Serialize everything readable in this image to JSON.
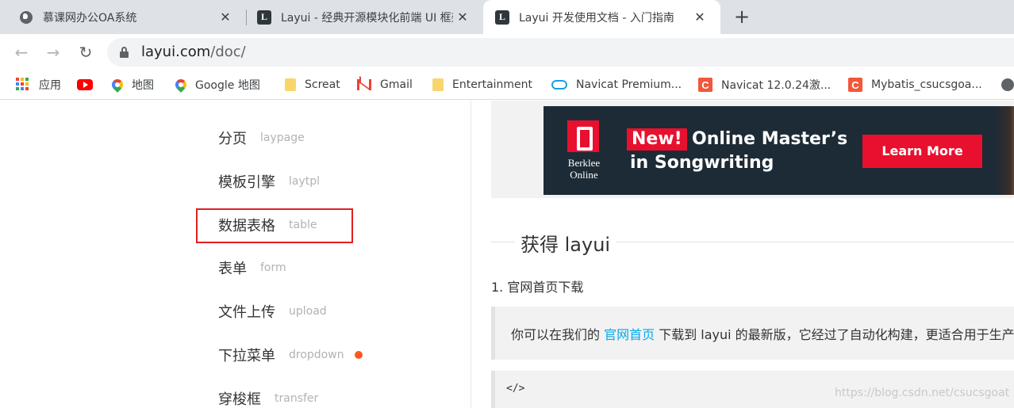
{
  "tabs": [
    {
      "title": "慕课网办公OA系统",
      "icon": "globe-icon",
      "active": false
    },
    {
      "title": "Layui - 经典开源模块化前端 UI 框架",
      "icon": "layui-logo-icon",
      "active": false
    },
    {
      "title": "Layui 开发使用文档 - 入门指南",
      "icon": "layui-logo-icon",
      "active": true
    }
  ],
  "toolbar": {
    "url_host": "layui.com",
    "url_path": "/doc/"
  },
  "bookmarks": [
    {
      "label": "应用",
      "icon": "apps-grid-icon"
    },
    {
      "label": "",
      "icon": "youtube-icon"
    },
    {
      "label": "地图",
      "icon": "maps-pin-icon"
    },
    {
      "label": "Google 地图",
      "icon": "maps-pin-icon"
    },
    {
      "label": "Screat",
      "icon": "folder-icon"
    },
    {
      "label": "Gmail",
      "icon": "gmail-icon"
    },
    {
      "label": "Entertainment",
      "icon": "folder-icon"
    },
    {
      "label": "Navicat Premium...",
      "icon": "cloud-icon"
    },
    {
      "label": "Navicat 12.0.24激...",
      "icon": "csdn-c-icon"
    },
    {
      "label": "Mybatis_csucsgoa...",
      "icon": "csdn-c-icon"
    }
  ],
  "sidebar": {
    "items": [
      {
        "zh": "分页",
        "en": "laypage"
      },
      {
        "zh": "模板引擎",
        "en": "laytpl"
      },
      {
        "zh": "数据表格",
        "en": "table"
      },
      {
        "zh": "表单",
        "en": "form"
      },
      {
        "zh": "文件上传",
        "en": "upload"
      },
      {
        "zh": "下拉菜单",
        "en": "dropdown"
      },
      {
        "zh": "穿梭框",
        "en": "transfer"
      }
    ]
  },
  "ad": {
    "brand_line1": "Berklee",
    "brand_line2": "Online",
    "badge": "New!",
    "headline1": "Online Master’s",
    "headline2": "in Songwriting",
    "cta": "Learn More"
  },
  "content": {
    "section_title": "获得 layui",
    "step1": "1. 官网首页下载",
    "quote_before": "你可以在我们的 ",
    "quote_link": "官网首页",
    "quote_after": " 下载到 layui 的最新版，它经过了自动化构建，更适合用于生产环境。",
    "code_text": "</>"
  },
  "watermark": "https://blog.csdn.net/csucsgoat",
  "colors": {
    "accent_link": "#01aaed",
    "highlight_box": "#e02020",
    "new_dot": "#ff5722",
    "ad_red": "#e8102e"
  }
}
